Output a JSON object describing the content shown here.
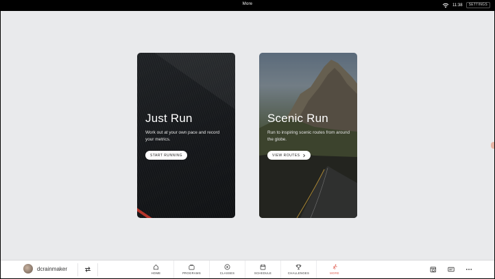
{
  "status_bar": {
    "title": "More",
    "time": "11:38",
    "settings_label": "SETTINGS"
  },
  "cards": [
    {
      "title": "Just Run",
      "description": "Work out at your own pace and record your metrics.",
      "button": "START RUNNING"
    },
    {
      "title": "Scenic Run",
      "description": "Run to inspiring scenic routes from around the globe.",
      "button": "VIEW ROUTES",
      "button_icon": "chevron-right-icon"
    }
  ],
  "user": {
    "name": "dcrainmaker"
  },
  "nav_tabs": [
    {
      "label": "HOME",
      "icon": "home-icon"
    },
    {
      "label": "PROGRAMS",
      "icon": "programs-icon"
    },
    {
      "label": "CLASSES",
      "icon": "play-icon"
    },
    {
      "label": "SCHEDULE",
      "icon": "calendar-icon"
    },
    {
      "label": "CHALLENGES",
      "icon": "trophy-icon"
    },
    {
      "label": "MORE",
      "icon": "runner-icon",
      "active": true
    }
  ],
  "right_icons": [
    "calendar-clock-icon",
    "card-icon",
    "more-icon"
  ],
  "colors": {
    "accent": "#e05a4c",
    "background": "#e9eaec",
    "status_bar": "#000000"
  }
}
